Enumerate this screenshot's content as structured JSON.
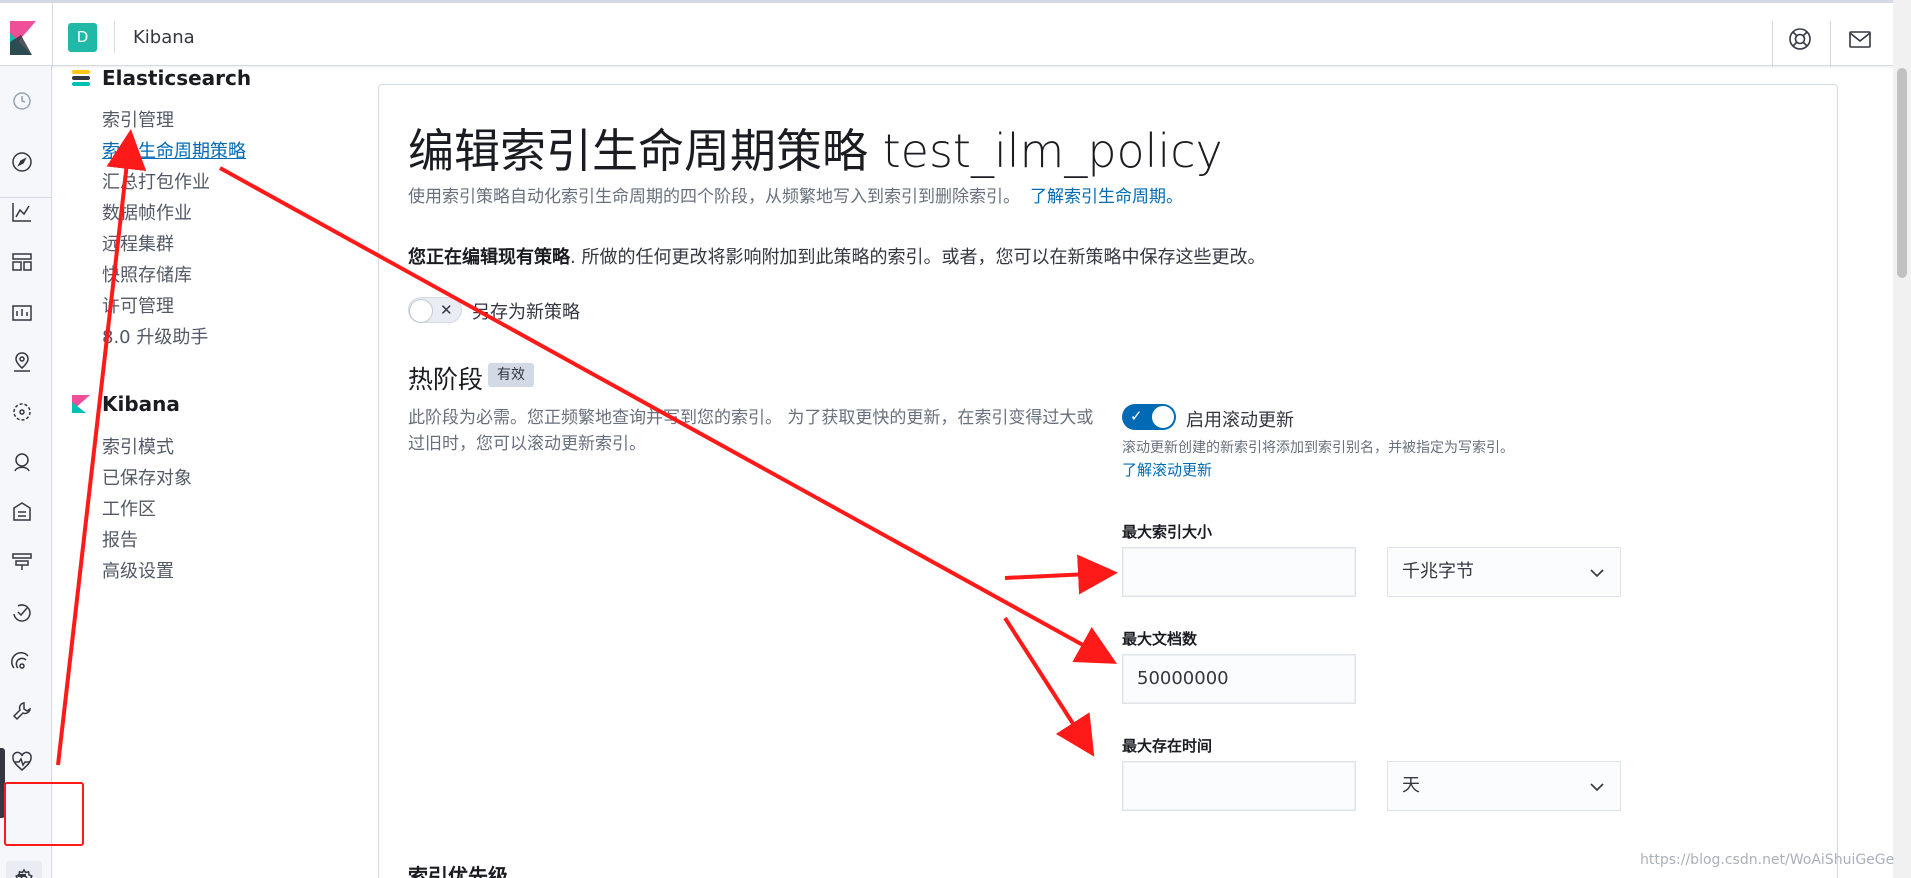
{
  "header": {
    "space_initial": "D",
    "app_title": "Kibana"
  },
  "sidebar": {
    "sections": [
      {
        "title": "Elasticsearch",
        "items": [
          "索引管理",
          "索引生命周期策略",
          "汇总打包作业",
          "数据帧作业",
          "远程集群",
          "快照存储库",
          "许可管理",
          "8.0 升级助手"
        ]
      },
      {
        "title": "Kibana",
        "items": [
          "索引模式",
          "已保存对象",
          "工作区",
          "报告",
          "高级设置"
        ]
      }
    ],
    "active_item": "索引生命周期策略"
  },
  "main": {
    "title": "编辑索引生命周期策略 test_ilm_policy",
    "description": "使用索引策略自动化索引生命周期的四个阶段，从频繁地写入到索引到删除索引。",
    "description_link": "了解索引生命周期。",
    "editing_bold": "您正在编辑现有策略",
    "editing_rest": ". 所做的任何更改将影响附加到此策略的索引。或者，您可以在新策略中保存这些更改。",
    "save_as_new_label": "另存为新策略",
    "save_as_new_enabled": false,
    "hot_phase": {
      "title": "热阶段",
      "badge": "有效",
      "description": "此阶段为必需。您正频繁地查询并写到您的索引。 为了获取更快的更新，在索引变得过大或过旧时，您可以滚动更新索引。",
      "rollover_label": "启用滚动更新",
      "rollover_enabled": true,
      "rollover_help": "滚动更新创建的新索引将添加到索引别名，并被指定为写索引。",
      "rollover_link": "了解滚动更新",
      "max_size_label": "最大索引大小",
      "max_size_value": "",
      "max_size_unit": "千兆字节",
      "max_docs_label": "最大文档数",
      "max_docs_value": "50000000",
      "max_age_label": "最大存在时间",
      "max_age_value": "",
      "max_age_unit": "天"
    },
    "index_priority_label": "索引优先级"
  },
  "watermark": "https://blog.csdn.net/WoAiShuiGeGe",
  "colors": {
    "accent": "#006bb4",
    "annotation": "#ff1a1a",
    "space_avatar": "#20b8a6"
  }
}
